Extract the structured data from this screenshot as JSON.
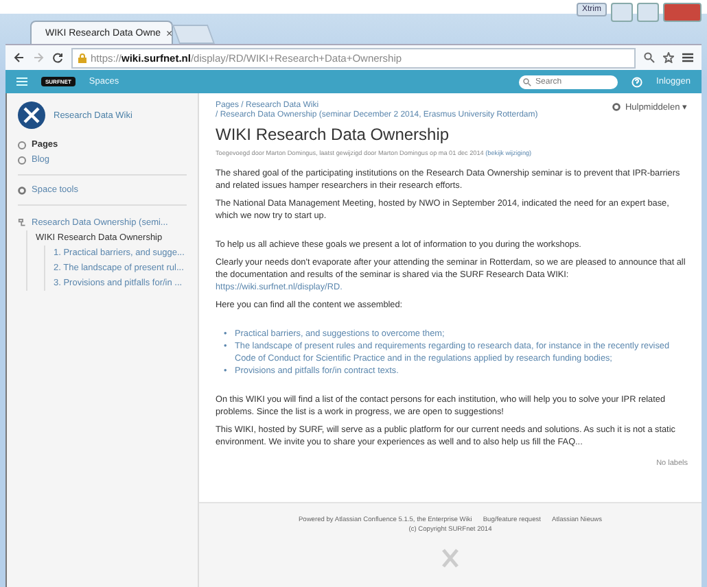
{
  "browser": {
    "tab_title": "WIKI Research Data Owne",
    "tab_close": "×",
    "user_badge": "Xtrim",
    "url_scheme": "https://",
    "url_host": "wiki.surfnet.nl",
    "url_path": "/display/RD/WIKI+Research+Data+Ownership"
  },
  "header": {
    "logo_text": "SURFNET",
    "spaces": "Spaces",
    "search": {
      "placeholder": "Search"
    },
    "login": "Inloggen"
  },
  "sidebar": {
    "space_name": "Research Data Wiki",
    "nav": [
      {
        "label": "Pages",
        "selected": true
      },
      {
        "label": "Blog",
        "selected": false
      }
    ],
    "space_tools": "Space tools",
    "tree": [
      {
        "label": "Research Data Ownership (semi...",
        "selected": false,
        "children": [
          {
            "label": "WIKI Research Data Ownership",
            "selected": true,
            "children": [
              {
                "label": "1. Practical barriers, and sugge...",
                "selected": false
              },
              {
                "label": "2. The landscape of present rul...",
                "selected": false
              },
              {
                "label": "3. Provisions and pitfalls for/in ...",
                "selected": false
              }
            ]
          }
        ]
      }
    ]
  },
  "page": {
    "breadcrumbs": [
      "Pages / Research Data Wiki",
      "/ Research Data Ownership (seminar December 2 2014, Erasmus University Rotterdam)"
    ],
    "tools": "Hulpmiddelen",
    "tools_caret": "▾",
    "title": "WIKI Research Data Ownership",
    "byline": {
      "text": "Toegevoegd door Marton Domingus, laatst gewijzigd door Marton Domingus op ma 01 dec 2014",
      "link": "(bekijk wijziging)"
    },
    "intro": [
      "The shared goal of the participating institutions on the Research Data Ownership seminar is to prevent that IPR-barriers and related issues hamper researchers in their research efforts.",
      "The National Data Management Meeting, hosted by NWO in September 2014, indicated the need for an expert base, which we now try to start up."
    ],
    "paragraphs": [
      {
        "text": "To help us all achieve these goals we present a lot of information to you during the workshops."
      },
      {
        "text": "Clearly your needs don't evaporate after your attending the seminar in Rotterdam, so we are pleased to announce that all the documentation and results of the seminar is shared via the SURF Research Data WIKI: ",
        "link": "https://wiki.surfnet.nl/display/RD."
      },
      {
        "text": "Here you can find all the content we assembled:"
      }
    ],
    "bullet": "•",
    "list": [
      "Practical barriers, and suggestions to overcome them;",
      "The landscape of present rules and requirements regarding to research data, for instance in the recently revised Code of Conduct for Scientific Practice and in the regulations applied by research funding bodies;",
      "Provisions and pitfalls for/in contract texts."
    ],
    "closing": [
      "On this WIKI you will find a list of the contact persons for each institution, who will help you to solve your IPR related problems. Since the list is a work in progress, we are open to suggestions!",
      "This WIKI, hosted by SURF, will serve as a public platform for our current needs and solutions. As such it is not a static environment. We invite you to share your experiences as well and to also help us fill the FAQ..."
    ],
    "labels": "No labels"
  },
  "footer": {
    "links": [
      "Powered by Atlassian Confluence 5.1.5, the Enterprise Wiki",
      "Bug/feature request",
      "Atlassian Nieuws"
    ],
    "copyright": "(c) Copyright SURFnet 2014"
  }
}
